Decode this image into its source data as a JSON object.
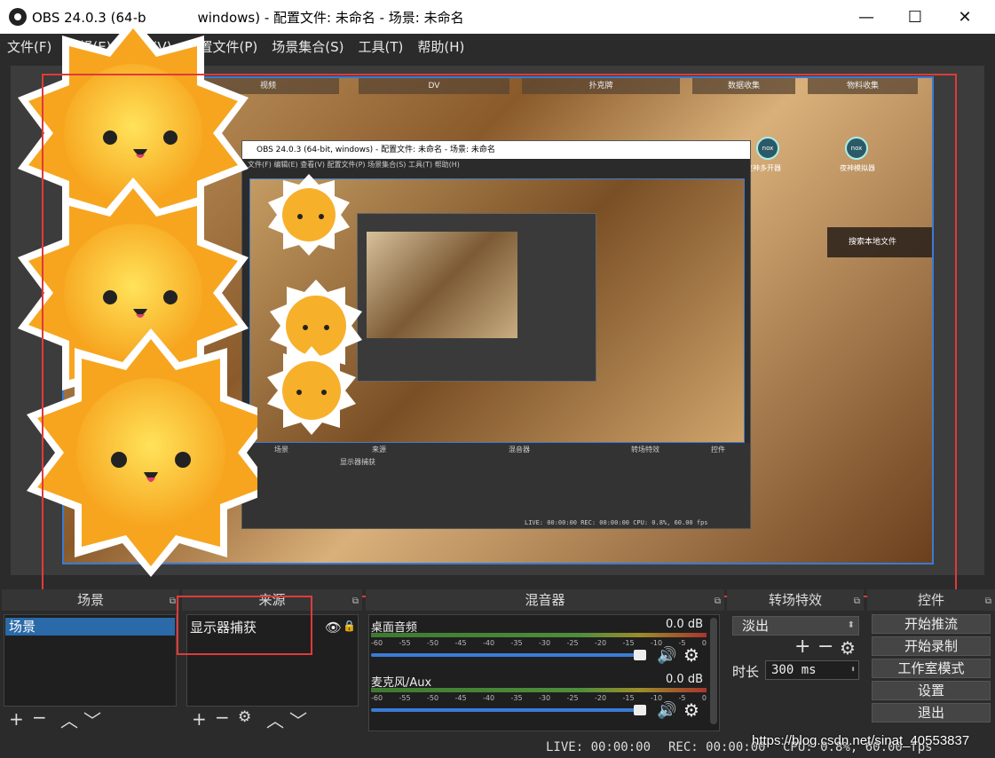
{
  "window": {
    "title": "OBS 24.0.3 (64-bit, windows) - 配置文件: 未命名 - 场景: 未命名",
    "title_visible": "OBS 24.0.3 (64-b",
    "title_tail": "windows) - 配置文件: 未命名 - 场景: 未命名",
    "minimize": "—",
    "maximize": "☐",
    "close": "✕"
  },
  "menu": [
    "文件(F)",
    "编辑(E)",
    "视图(V)",
    "配置文件(P)",
    "场景集合(S)",
    "工具(T)",
    "帮助(H)"
  ],
  "desktop": {
    "folders": [
      "视频",
      "DV",
      "扑克牌",
      "数据收集",
      "物料收集"
    ],
    "icons": [
      "nox",
      "nox"
    ],
    "icon_labels": [
      "夜神多开器",
      "夜神模拟器"
    ],
    "search_label": "搜索本地文件"
  },
  "nested": {
    "title": "OBS 24.0.3 (64-bit, windows) - 配置文件: 未命名 - 场景: 未命名",
    "menu": "文件(F) 编辑(E) 查看(V) 配置文件(P) 场景集合(S) 工具(T) 帮助(H)",
    "docks": [
      "场景",
      "来源",
      "混音器",
      "转场特效",
      "控件"
    ],
    "source": "显示器捕获",
    "status": "LIVE: 00:00:00   REC: 00:00:00   CPU: 0.8%, 60.00 fps"
  },
  "docks": {
    "scenes": {
      "title": "场景",
      "items": [
        "场景"
      ]
    },
    "sources": {
      "title": "来源",
      "items": [
        "显示器捕获"
      ]
    },
    "mixer": {
      "title": "混音器",
      "channels": [
        {
          "name": "桌面音频",
          "db": "0.0 dB"
        },
        {
          "name": "麦克风/Aux",
          "db": "0.0 dB"
        }
      ],
      "ticks": [
        "-60",
        "-55",
        "-50",
        "-45",
        "-40",
        "-35",
        "-30",
        "-25",
        "-20",
        "-15",
        "-10",
        "-5",
        "0"
      ]
    },
    "transitions": {
      "title": "转场特效",
      "selected": "淡出",
      "duration_label": "时长",
      "duration": "300 ms"
    },
    "controls": {
      "title": "控件",
      "buttons": [
        "开始推流",
        "开始录制",
        "工作室模式",
        "设置",
        "退出"
      ]
    }
  },
  "status": {
    "live": "LIVE: 00:00:00",
    "rec": "REC: 00:00:00",
    "cpu": "CPU: 0.8%, 60.00 fps"
  },
  "watermark": "https://blog.csdn.net/sinat_40553837"
}
